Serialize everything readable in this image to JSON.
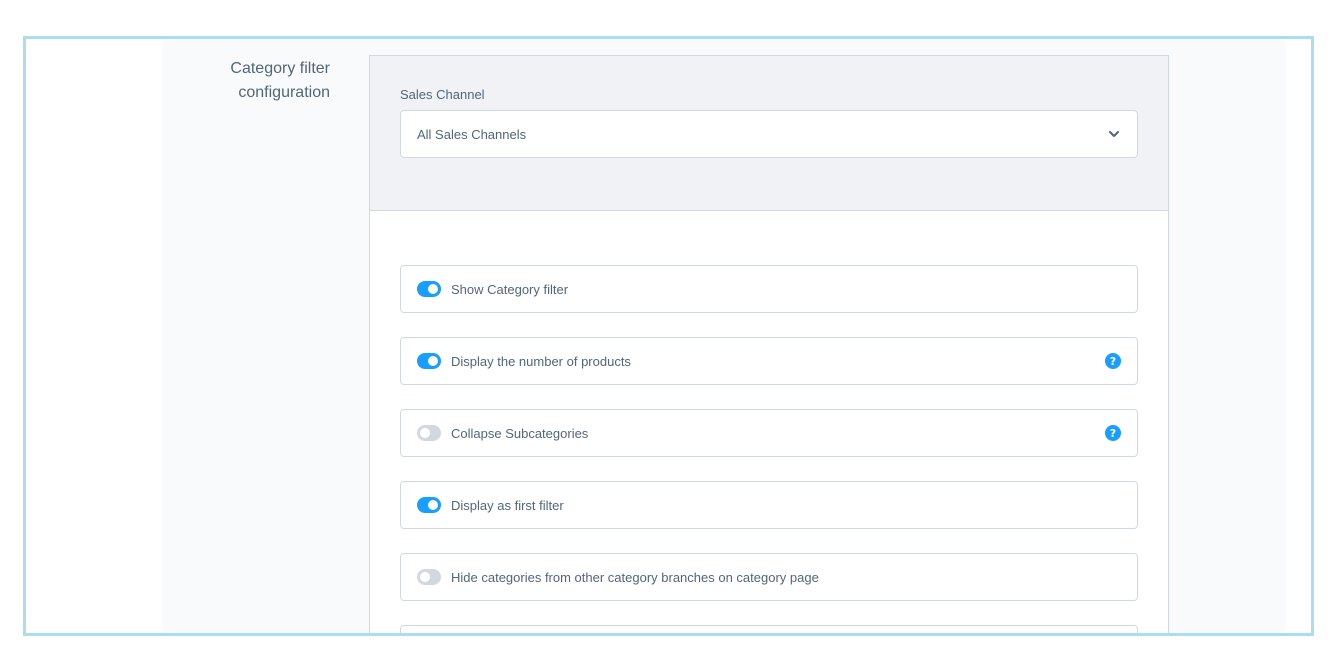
{
  "section": {
    "title_line1": "Category filter",
    "title_line2": "configuration"
  },
  "sales_channel": {
    "label": "Sales Channel",
    "selected": "All Sales Channels"
  },
  "options": [
    {
      "label": "Show Category filter",
      "enabled": true,
      "help": false
    },
    {
      "label": "Display the number of products",
      "enabled": true,
      "help": true
    },
    {
      "label": "Collapse Subcategories",
      "enabled": false,
      "help": true
    },
    {
      "label": "Display as first filter",
      "enabled": true,
      "help": false
    },
    {
      "label": "Hide categories from other category branches on category page",
      "enabled": false,
      "help": false
    }
  ],
  "help_icon_text": "?",
  "colors": {
    "accent": "#189eff",
    "switch_off": "#d1d9e0",
    "frame_border": "#aadcf5",
    "header_bg": "#f0f2f5"
  },
  "icons": {
    "select_chevron": "chevron-down-icon",
    "help": "question-circle-icon"
  }
}
